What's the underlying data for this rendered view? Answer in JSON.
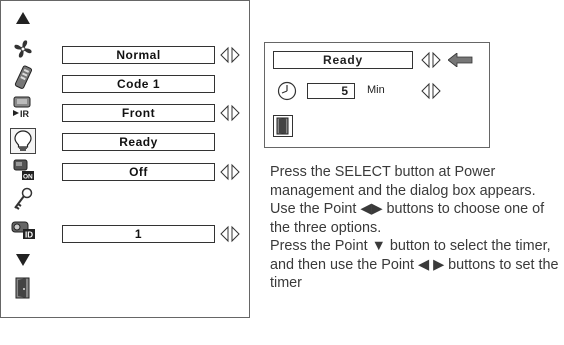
{
  "menu": {
    "fields": [
      {
        "id": "fan",
        "value": "Normal",
        "has_arrows": true
      },
      {
        "id": "remote",
        "value": "Code 1",
        "has_arrows": false
      },
      {
        "id": "ceiling",
        "value": "Front",
        "has_arrows": true
      },
      {
        "id": "power-management",
        "value": "Ready",
        "has_arrows": false
      },
      {
        "id": "on-start",
        "value": "Off",
        "has_arrows": true
      },
      {
        "id": "logo-id",
        "value": "1",
        "has_arrows": true
      }
    ],
    "side_icons": [
      "up-arrow-icon",
      "fan-icon",
      "remote-control-icon",
      "ir-receiver-icon",
      "lightbulb-icon",
      "power-on-icon",
      "key-icon",
      "projector-id-icon",
      "down-arrow-icon",
      "exit-door-icon"
    ],
    "selected_icon": "lightbulb-icon"
  },
  "dialog": {
    "mode_value": "Ready",
    "timer_value": "5",
    "timer_unit": "Min"
  },
  "instructions": {
    "paragraph1": "Press the SELECT button at Power management and the dialog box appears.  Use the Point ◀▶ buttons to choose one of the three options.",
    "paragraph2": "Press the Point ▼ button to select the timer, and then use the Point ◀ ▶ buttons to set the timer"
  }
}
